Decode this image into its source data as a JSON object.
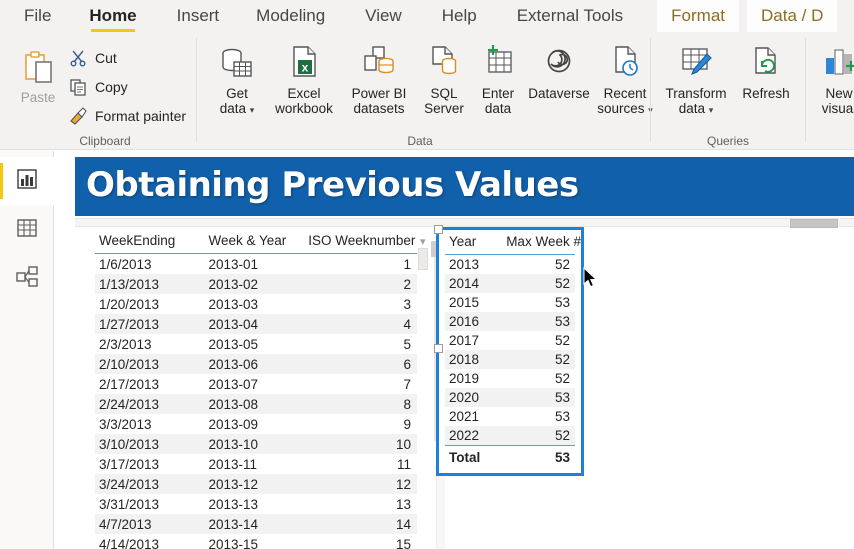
{
  "ribbon": {
    "tabs": [
      {
        "label": "File",
        "state": "normal"
      },
      {
        "label": "Home",
        "state": "active"
      },
      {
        "label": "Insert",
        "state": "normal"
      },
      {
        "label": "Modeling",
        "state": "normal"
      },
      {
        "label": "View",
        "state": "normal"
      },
      {
        "label": "Help",
        "state": "normal"
      },
      {
        "label": "External Tools",
        "state": "normal"
      },
      {
        "label": "Format",
        "state": "contextual"
      },
      {
        "label": "Data / D",
        "state": "contextual"
      }
    ],
    "groups": [
      {
        "name": "Clipboard"
      },
      {
        "name": "Data"
      },
      {
        "name": "Queries"
      }
    ],
    "clipboard": {
      "paste": {
        "label": "Paste",
        "icon": "clipboard-icon"
      },
      "cut": {
        "label": "Cut",
        "icon": "scissors-icon"
      },
      "copy": {
        "label": "Copy",
        "icon": "copy-icon"
      },
      "format_painter": {
        "label": "Format painter",
        "icon": "paintbrush-icon"
      }
    },
    "data": [
      {
        "line1": "Get",
        "line2": "data",
        "icon": "database-table-icon",
        "chevron": true
      },
      {
        "line1": "Excel",
        "line2": "workbook",
        "icon": "excel-file-icon",
        "chevron": false
      },
      {
        "line1": "Power BI",
        "line2": "datasets",
        "icon": "powerbi-dataset-icon",
        "chevron": false
      },
      {
        "line1": "SQL",
        "line2": "Server",
        "icon": "sql-server-icon",
        "chevron": false
      },
      {
        "line1": "Enter",
        "line2": "data",
        "icon": "enter-data-icon",
        "chevron": false
      },
      {
        "line1": "Dataverse",
        "line2": "",
        "icon": "dataverse-icon",
        "chevron": false
      },
      {
        "line1": "Recent",
        "line2": "sources",
        "icon": "recent-sources-icon",
        "chevron": true
      }
    ],
    "queries": [
      {
        "line1": "Transform",
        "line2": "data",
        "icon": "transform-data-icon",
        "chevron": true
      },
      {
        "line1": "Refresh",
        "line2": "",
        "icon": "refresh-icon",
        "chevron": false
      }
    ],
    "insert": [
      {
        "line1": "New",
        "line2": "visual",
        "icon": "new-visual-icon",
        "chevron": false
      }
    ]
  },
  "leftnav": {
    "items": [
      {
        "name": "report-view",
        "icon": "bar-chart-icon",
        "selected": true
      },
      {
        "name": "data-view",
        "icon": "table-grid-icon",
        "selected": false
      },
      {
        "name": "model-view",
        "icon": "model-nodes-icon",
        "selected": false
      }
    ]
  },
  "canvas": {
    "banner_title": "Obtaining Previous Values",
    "banner_color": "#1160ab",
    "accent_selection_color": "#1f7fdb",
    "left_table": {
      "name": "weekending-table",
      "columns": [
        "WeekEnding",
        "Week & Year",
        "ISO Weeknumber"
      ],
      "rows": [
        [
          "1/6/2013",
          "2013-01",
          "1"
        ],
        [
          "1/13/2013",
          "2013-02",
          "2"
        ],
        [
          "1/20/2013",
          "2013-03",
          "3"
        ],
        [
          "1/27/2013",
          "2013-04",
          "4"
        ],
        [
          "2/3/2013",
          "2013-05",
          "5"
        ],
        [
          "2/10/2013",
          "2013-06",
          "6"
        ],
        [
          "2/17/2013",
          "2013-07",
          "7"
        ],
        [
          "2/24/2013",
          "2013-08",
          "8"
        ],
        [
          "3/3/2013",
          "2013-09",
          "9"
        ],
        [
          "3/10/2013",
          "2013-10",
          "10"
        ],
        [
          "3/17/2013",
          "2013-11",
          "11"
        ],
        [
          "3/24/2013",
          "2013-12",
          "12"
        ],
        [
          "3/31/2013",
          "2013-13",
          "13"
        ],
        [
          "4/7/2013",
          "2013-14",
          "14"
        ],
        [
          "4/14/2013",
          "2013-15",
          "15"
        ]
      ]
    },
    "right_table": {
      "name": "max-week-table",
      "selected": true,
      "columns": [
        "Year",
        "Max Week #"
      ],
      "rows": [
        [
          "2013",
          "52"
        ],
        [
          "2014",
          "52"
        ],
        [
          "2015",
          "53"
        ],
        [
          "2016",
          "53"
        ],
        [
          "2017",
          "52"
        ],
        [
          "2018",
          "52"
        ],
        [
          "2019",
          "52"
        ],
        [
          "2020",
          "53"
        ],
        [
          "2021",
          "53"
        ],
        [
          "2022",
          "52"
        ]
      ],
      "total_row": [
        "Total",
        "53"
      ]
    }
  },
  "chart_data": {
    "type": "table",
    "title": "Obtaining Previous Values",
    "tables": [
      {
        "name": "WeekEnding / Week & Year / ISO Weeknumber",
        "columns": [
          "WeekEnding",
          "Week & Year",
          "ISO Weeknumber"
        ],
        "rows": [
          [
            "1/6/2013",
            "2013-01",
            1
          ],
          [
            "1/13/2013",
            "2013-02",
            2
          ],
          [
            "1/20/2013",
            "2013-03",
            3
          ],
          [
            "1/27/2013",
            "2013-04",
            4
          ],
          [
            "2/3/2013",
            "2013-05",
            5
          ],
          [
            "2/10/2013",
            "2013-06",
            6
          ],
          [
            "2/17/2013",
            "2013-07",
            7
          ],
          [
            "2/24/2013",
            "2013-08",
            8
          ],
          [
            "3/3/2013",
            "2013-09",
            9
          ],
          [
            "3/10/2013",
            "2013-10",
            10
          ],
          [
            "3/17/2013",
            "2013-11",
            11
          ],
          [
            "3/24/2013",
            "2013-12",
            12
          ],
          [
            "3/31/2013",
            "2013-13",
            13
          ],
          [
            "4/7/2013",
            "2013-14",
            14
          ],
          [
            "4/14/2013",
            "2013-15",
            15
          ]
        ]
      },
      {
        "name": "Year / Max Week #",
        "columns": [
          "Year",
          "Max Week #"
        ],
        "rows": [
          [
            2013,
            52
          ],
          [
            2014,
            52
          ],
          [
            2015,
            53
          ],
          [
            2016,
            53
          ],
          [
            2017,
            52
          ],
          [
            2018,
            52
          ],
          [
            2019,
            52
          ],
          [
            2020,
            53
          ],
          [
            2021,
            53
          ],
          [
            2022,
            52
          ]
        ],
        "total": [
          "Total",
          53
        ]
      }
    ]
  }
}
